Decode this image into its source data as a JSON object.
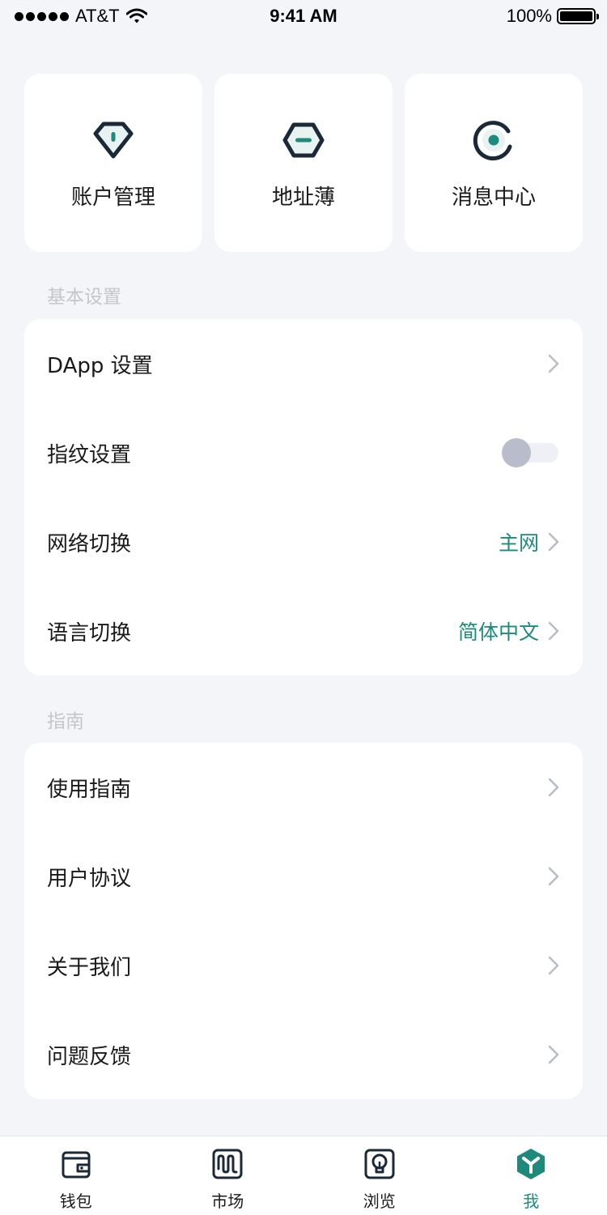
{
  "status_bar": {
    "carrier": "AT&T",
    "time": "9:41 AM",
    "battery_text": "100%",
    "battery_level": 1.0
  },
  "top_cards": [
    {
      "label": "账户管理",
      "icon": "account-shield-icon"
    },
    {
      "label": "地址薄",
      "icon": "address-book-icon"
    },
    {
      "label": "消息中心",
      "icon": "message-center-icon"
    }
  ],
  "basic_settings": {
    "title": "基本设置",
    "items": [
      {
        "label": "DApp 设置",
        "value": ""
      },
      {
        "label": "指纹设置",
        "toggle_on": false
      },
      {
        "label": "网络切换",
        "value": "主网"
      },
      {
        "label": "语言切换",
        "value": "简体中文"
      }
    ]
  },
  "guide": {
    "title": "指南",
    "items": [
      {
        "label": "使用指南"
      },
      {
        "label": "用户协议"
      },
      {
        "label": "关于我们"
      },
      {
        "label": "问题反馈"
      }
    ]
  },
  "tab_bar": {
    "tabs": [
      {
        "label": "钱包",
        "icon": "wallet-icon",
        "active": false
      },
      {
        "label": "市场",
        "icon": "market-icon",
        "active": false
      },
      {
        "label": "浏览",
        "icon": "browse-icon",
        "active": false
      },
      {
        "label": "我",
        "icon": "me-icon",
        "active": true
      }
    ]
  },
  "colors": {
    "accent": "#1d8a7c",
    "icon_dark": "#1b2838",
    "background": "#f4f5f9",
    "section_title": "#c4c6cc"
  }
}
